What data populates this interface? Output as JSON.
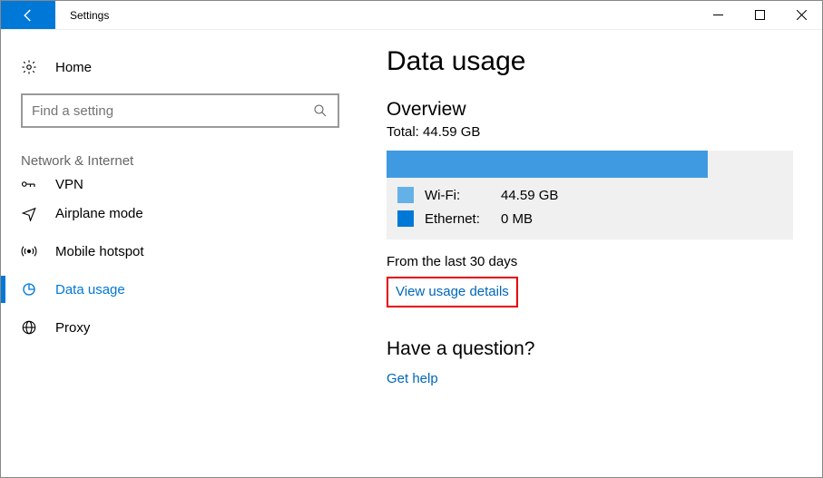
{
  "window": {
    "title": "Settings"
  },
  "sidebar": {
    "home_label": "Home",
    "search_placeholder": "Find a setting",
    "section_label": "Network & Internet",
    "items": [
      {
        "label": "VPN"
      },
      {
        "label": "Airplane mode"
      },
      {
        "label": "Mobile hotspot"
      },
      {
        "label": "Data usage"
      },
      {
        "label": "Proxy"
      }
    ]
  },
  "main": {
    "page_title": "Data usage",
    "overview_title": "Overview",
    "total_label": "Total: 44.59 GB",
    "legend": [
      {
        "label": "Wi-Fi:",
        "value": "44.59 GB",
        "color": "#64b1e8"
      },
      {
        "label": "Ethernet:",
        "value": "0 MB",
        "color": "#0078d7"
      }
    ],
    "period_label": "From the last 30 days",
    "details_link": "View usage details",
    "question_title": "Have a question?",
    "help_link": "Get help"
  }
}
